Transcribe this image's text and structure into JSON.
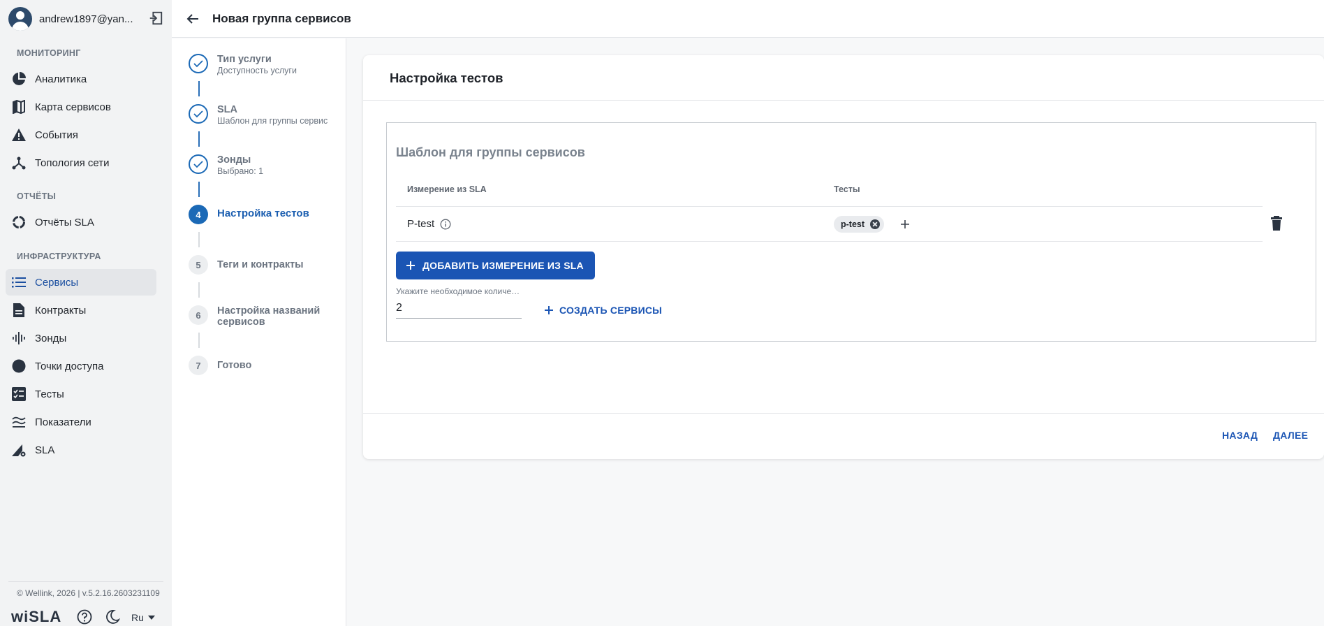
{
  "user": {
    "name": "andrew1897@yan...",
    "avatar_icon": "user-avatar-icon",
    "logout_icon": "logout-icon"
  },
  "sidebar": {
    "sections": [
      {
        "title": "МОНИТОРИНГ",
        "items": [
          {
            "label": "Аналитика",
            "icon": "pie-chart-icon"
          },
          {
            "label": "Карта сервисов",
            "icon": "map-icon"
          },
          {
            "label": "События",
            "icon": "warning-icon"
          },
          {
            "label": "Топология сети",
            "icon": "topology-icon"
          }
        ]
      },
      {
        "title": "ОТЧЁТЫ",
        "items": [
          {
            "label": "Отчёты SLA",
            "icon": "report-ring-icon"
          }
        ]
      },
      {
        "title": "ИНФРАСТРУКТУРА",
        "items": [
          {
            "label": "Сервисы",
            "icon": "list-icon",
            "active": true
          },
          {
            "label": "Контракты",
            "icon": "document-icon"
          },
          {
            "label": "Зонды",
            "icon": "signal-bars-icon"
          },
          {
            "label": "Точки доступа",
            "icon": "circle-icon"
          },
          {
            "label": "Тесты",
            "icon": "checklist-icon"
          },
          {
            "label": "Показатели",
            "icon": "metrics-icon"
          },
          {
            "label": "SLA",
            "icon": "sla-icon"
          }
        ]
      }
    ],
    "copyright": "© Wellink, 2026 | v.5.2.16.2603231109",
    "brand": "wiSLA",
    "language": "Ru"
  },
  "header": {
    "title": "Новая группа сервисов"
  },
  "stepper": {
    "steps": [
      {
        "num": "1",
        "label": "Тип услуги",
        "sub": "Доступность услуги",
        "state": "done"
      },
      {
        "num": "2",
        "label": "SLA",
        "sub": "Шаблон для группы сервис",
        "state": "done"
      },
      {
        "num": "3",
        "label": "Зонды",
        "sub": "Выбрано: 1",
        "state": "done"
      },
      {
        "num": "4",
        "label": "Настройка тестов",
        "sub": "",
        "state": "current"
      },
      {
        "num": "5",
        "label": "Теги и контракты",
        "sub": "",
        "state": "todo"
      },
      {
        "num": "6",
        "label": "Настройка названий сервисов",
        "sub": "",
        "state": "todo"
      },
      {
        "num": "7",
        "label": "Готово",
        "sub": "",
        "state": "todo"
      }
    ]
  },
  "main": {
    "title": "Настройка тестов",
    "template_title": "Шаблон для группы сервисов",
    "columns": {
      "measure": "Измерение из SLA",
      "tests": "Тесты"
    },
    "rows": [
      {
        "measure": "P-test",
        "tests": [
          "p-test"
        ]
      }
    ],
    "add_measure_button": "ДОБАВИТЬ ИЗМЕРЕНИЕ ИЗ SLA",
    "count_label": "Укажите необходимое количество сервисов",
    "count_value": "2",
    "create_services_button": "СОЗДАТЬ СЕРВИСЫ",
    "back_button": "НАЗАД",
    "next_button": "ДАЛЕЕ"
  },
  "colors": {
    "accent": "#1b55b4",
    "step_active": "#1b69b6",
    "sidebar_bg": "#f2f3f4"
  }
}
